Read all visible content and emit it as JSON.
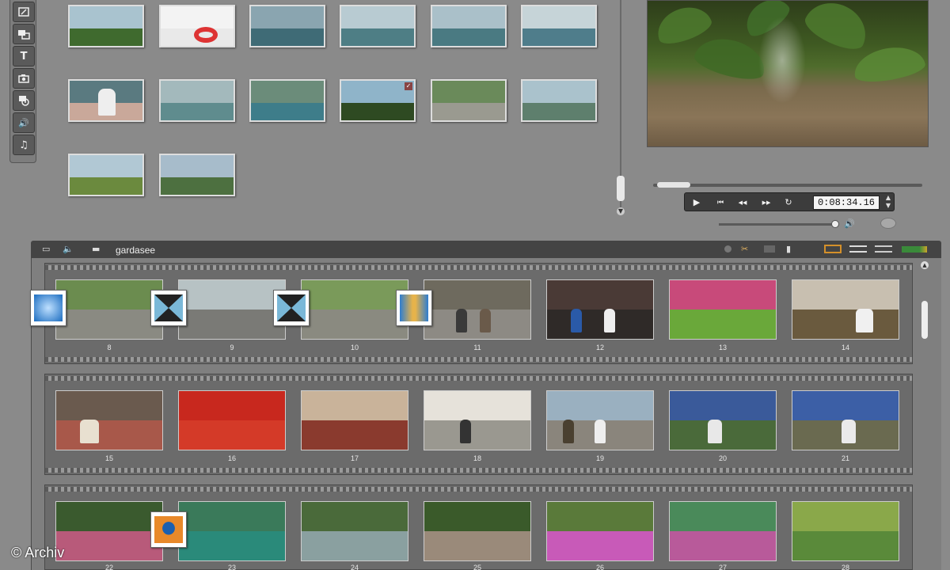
{
  "toolbar": {
    "tools": [
      {
        "name": "video-clips-tool",
        "icon": "film-edit-icon",
        "glyph": ""
      },
      {
        "name": "transitions-tool",
        "icon": "transitions-icon",
        "glyph": ""
      },
      {
        "name": "titles-tool",
        "icon": "title-text-icon",
        "glyph": "T"
      },
      {
        "name": "photos-tool",
        "icon": "camera-icon",
        "glyph": ""
      },
      {
        "name": "disc-menus-tool",
        "icon": "disc-menu-icon",
        "glyph": ""
      },
      {
        "name": "sound-effects-tool",
        "icon": "speaker-icon",
        "glyph": "🔊"
      },
      {
        "name": "music-tool",
        "icon": "music-note-icon",
        "glyph": "♫"
      }
    ]
  },
  "player": {
    "timecode": "0:08:34.16",
    "transport": [
      {
        "name": "play-button",
        "glyph": "▶"
      },
      {
        "name": "go-to-start-button",
        "glyph": "⏮"
      },
      {
        "name": "step-back-button",
        "glyph": "◀◀"
      },
      {
        "name": "step-forward-button",
        "glyph": "▶▶"
      },
      {
        "name": "loop-button",
        "glyph": "↻"
      }
    ]
  },
  "storyboard": {
    "project_name": "gardasee",
    "rows": [
      {
        "clips": [
          "8",
          "9",
          "10",
          "11",
          "12",
          "13",
          "14"
        ]
      },
      {
        "clips": [
          "15",
          "16",
          "17",
          "18",
          "19",
          "20",
          "21"
        ]
      },
      {
        "clips": [
          "22",
          "23",
          "24",
          "25",
          "26",
          "27",
          "28"
        ]
      }
    ]
  },
  "watermark": "© Archiv"
}
